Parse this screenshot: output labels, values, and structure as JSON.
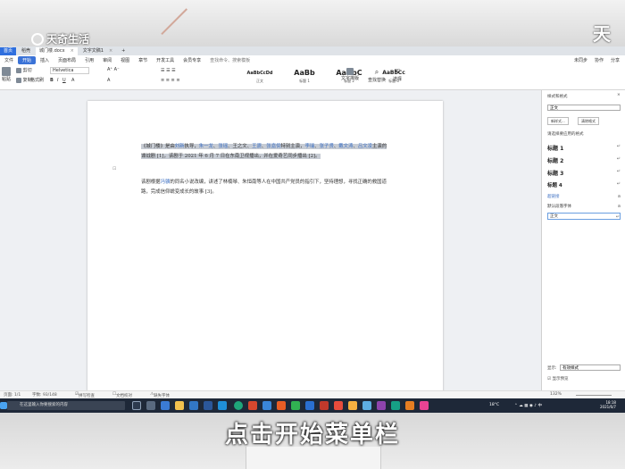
{
  "brand": {
    "left": "天奇生活",
    "right": "天奇"
  },
  "tabs": [
    {
      "label": "首页",
      "type": "home"
    },
    {
      "label": "稻壳",
      "type": "normal"
    },
    {
      "label": "城门楼.docx",
      "type": "active"
    },
    {
      "label": "文字文稿1",
      "type": "normal"
    }
  ],
  "menu": {
    "items": [
      "文件",
      "开始",
      "插入",
      "页面布局",
      "引用",
      "审阅",
      "视图",
      "章节",
      "开发工具",
      "会员专享"
    ],
    "search": "查找命令、搜索模板",
    "right": [
      "未同步",
      "协作",
      "分享"
    ]
  },
  "ribbon": {
    "paste": "粘贴",
    "cut": "剪切",
    "copy": "复制",
    "format_painter": "格式刷",
    "font_name": "Helvetica",
    "styles": [
      {
        "sample": "AaBbCcDd",
        "label": "正文"
      },
      {
        "sample": "AaBb",
        "label": "标题 1"
      },
      {
        "sample": "AaBbC",
        "label": "标题 2"
      },
      {
        "sample": "AaBbCc",
        "label": "标题 3"
      }
    ],
    "text_tools": "文字排版",
    "find_replace": "查找替换",
    "select": "选择"
  },
  "document": {
    "p1": [
      {
        "t": "《城门楼》是由",
        "c": "normal"
      },
      {
        "t": "刘新",
        "c": "link"
      },
      {
        "t": "执导，",
        "c": "normal"
      },
      {
        "t": "朱一龙",
        "c": "link"
      },
      {
        "t": "、",
        "c": "normal"
      },
      {
        "t": "张瑶",
        "c": "link"
      },
      {
        "t": "、王之文、",
        "c": "normal"
      },
      {
        "t": "王骁",
        "c": "link"
      },
      {
        "t": "、",
        "c": "normal"
      },
      {
        "t": "张嘉倪",
        "c": "link"
      },
      {
        "t": "特别主演，",
        "c": "normal"
      },
      {
        "t": "李瑞",
        "c": "link"
      },
      {
        "t": "、",
        "c": "normal"
      },
      {
        "t": "张子贤",
        "c": "link"
      },
      {
        "t": "、",
        "c": "normal"
      },
      {
        "t": "戴文涛",
        "c": "link"
      },
      {
        "t": "、",
        "c": "normal"
      },
      {
        "t": "吕文凌",
        "c": "link"
      },
      {
        "t": "主演的谍战剧 [1]，该剧于 2021 年 6 月 7 日在东南卫视播出，并在爱奇艺同步播出 [2]。",
        "c": "normal"
      }
    ],
    "p2": [
      {
        "t": "该剧根据",
        "c": "normal"
      },
      {
        "t": "冯骥",
        "c": "link"
      },
      {
        "t": "的同名小说改编，讲述了林楠琴、朱恒南等人在中国共产党员的指引下，坚持理想，寻找正确的救国道路，完成信仰蜕变成长的故事 [3]。",
        "c": "normal"
      }
    ]
  },
  "panel": {
    "title": "样式和格式",
    "current_style": "正文",
    "new_style": "新样式...",
    "clear_format": "清除格式",
    "apply_label": "请选择要应用的格式",
    "styles": [
      {
        "label": "标题 1",
        "mark": "↵"
      },
      {
        "label": "标题 2",
        "mark": "↵"
      },
      {
        "label": "标题 3",
        "mark": "↵"
      },
      {
        "label": "标题 4",
        "mark": "↵"
      }
    ],
    "small_styles": [
      {
        "label": "超链接",
        "mark": "a"
      },
      {
        "label": "默认段落字体",
        "mark": "a"
      },
      {
        "label": "正文",
        "mark": "↵"
      }
    ],
    "show_label": "显示:",
    "show_value": "有效样式",
    "preview_label": "显示预览"
  },
  "status": {
    "page": "页面: 1/1",
    "words": "字数: 93/148",
    "spell": "拼写检查",
    "doc_check": "文档校对",
    "missing_font": "缺失字体",
    "zoom": "132%"
  },
  "taskbar": {
    "search_placeholder": "在这里输入你要搜索的内容",
    "weather": "18°C",
    "time": "18:18",
    "date": "2021/6/7"
  },
  "caption": "点击开始菜单栏"
}
